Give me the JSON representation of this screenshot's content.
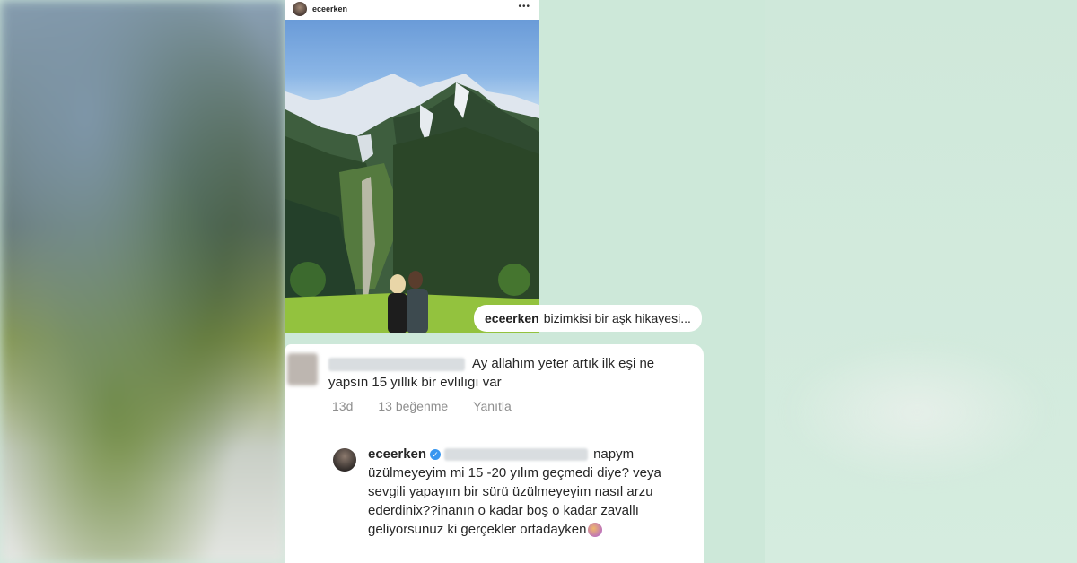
{
  "post": {
    "username": "eceerken",
    "more_icon": "more-horizontal-icon",
    "caption_user": "eceerken",
    "caption_text": "bizimkisi bir aşk hikayesi..."
  },
  "comment1": {
    "text": "Ay allahım yeter artık ilk eşi ne yapsın 15 yıllık bir evlılıgı var",
    "time": "13d",
    "likes": "13 beğenme",
    "reply": "Yanıtla"
  },
  "comment2": {
    "username": "eceerken",
    "text": "napym üzülmeyeyim mi 15 -20 yılım geçmedi diye? veya sevgili yapayım bir sürü üzülmeyeyim nasıl arzu ederdinix??inanın o kadar boş o kadar zavallı geliyorsunuz ki gerçekler ortadayken",
    "emoji_icon": "crying-face-emoji-icon"
  },
  "colors": {
    "background": "#cde8d9",
    "verified": "#3897f0",
    "meta_text": "#8e8e8e"
  }
}
